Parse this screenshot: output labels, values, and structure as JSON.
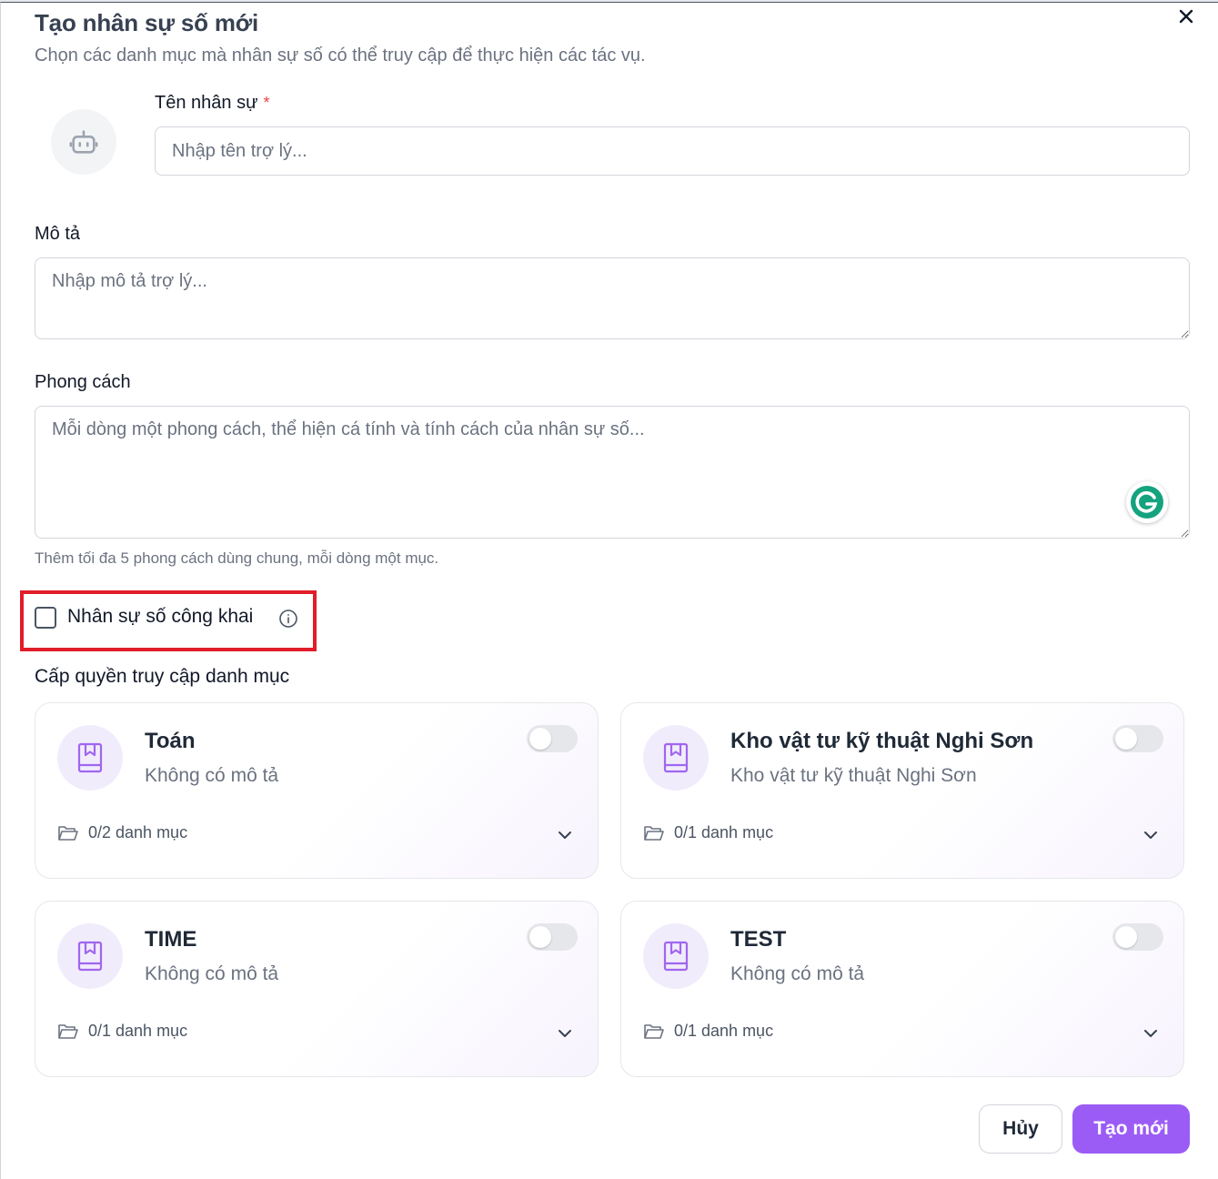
{
  "dialog": {
    "title": "Tạo nhân sự số mới",
    "subtitle": "Chọn các danh mục mà nhân sự số có thể truy cập để thực hiện các tác vụ."
  },
  "name_field": {
    "label": "Tên nhân sự",
    "required_mark": "*",
    "placeholder": "Nhập tên trợ lý..."
  },
  "description_field": {
    "label": "Mô tả",
    "placeholder": "Nhập mô tả trợ lý..."
  },
  "style_field": {
    "label": "Phong cách",
    "placeholder": "Mỗi dòng một phong cách, thể hiện cá tính và tính cách của nhân sự số...",
    "hint": "Thêm tối đa 5 phong cách dùng chung, mỗi dòng một mục."
  },
  "public_option": {
    "label": "Nhân sự số công khai",
    "checked": false
  },
  "access_section": {
    "label": "Cấp quyền truy cập danh mục",
    "cards": [
      {
        "title": "Toán",
        "description": "Không có mô tả",
        "count": "0/2 danh mục",
        "enabled": false
      },
      {
        "title": "Kho vật tư kỹ thuật Nghi Sơn",
        "description": "Kho vật tư kỹ thuật Nghi Sơn",
        "count": "0/1 danh mục",
        "enabled": false
      },
      {
        "title": "TIME",
        "description": "Không có mô tả",
        "count": "0/1 danh mục",
        "enabled": false
      },
      {
        "title": "TEST",
        "description": "Không có mô tả",
        "count": "0/1 danh mục",
        "enabled": false
      }
    ]
  },
  "actions": {
    "cancel": "Hủy",
    "create": "Tạo mới"
  },
  "colors": {
    "primary": "#9b5cf6",
    "highlight": "#e11d2a",
    "required": "#ef4444",
    "grammarly": "#15a37f"
  }
}
